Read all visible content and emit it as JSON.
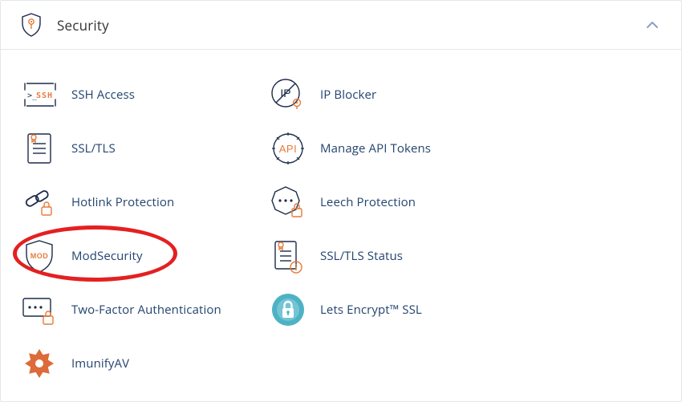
{
  "panel": {
    "title": "Security"
  },
  "col1": [
    {
      "label": "SSH Access"
    },
    {
      "label": "SSL/TLS"
    },
    {
      "label": "Hotlink Protection"
    },
    {
      "label": "ModSecurity"
    },
    {
      "label": "Two-Factor Authentication"
    },
    {
      "label": "ImunifyAV"
    }
  ],
  "col2": [
    {
      "label": "IP Blocker"
    },
    {
      "label": "Manage API Tokens"
    },
    {
      "label": "Leech Protection"
    },
    {
      "label": "SSL/TLS Status"
    },
    {
      "label": "Lets Encrypt™ SSL"
    }
  ],
  "highlight": {
    "column": 1,
    "index": 3
  }
}
